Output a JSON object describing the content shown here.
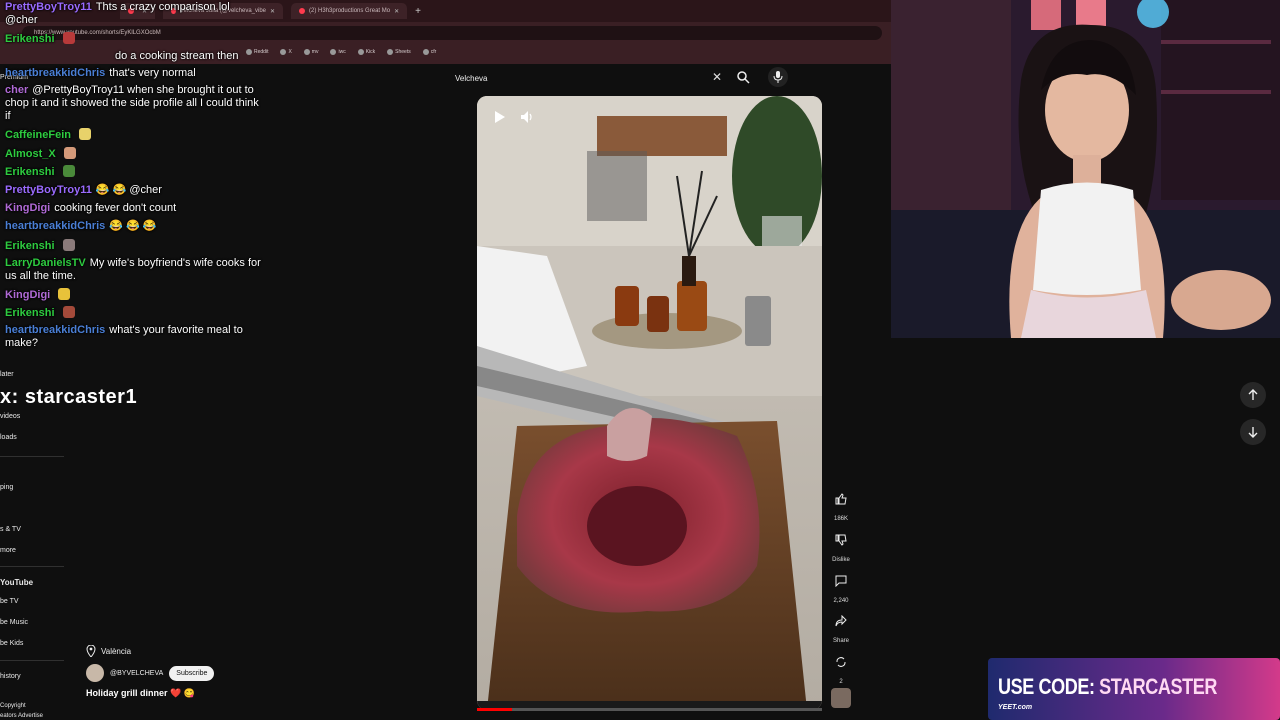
{
  "browser": {
    "tabs": [
      {
        "label": ""
      },
      {
        "label": "Velcheva Julia (@velcheva_vibe"
      },
      {
        "label": "(2) H3h3productions Great Mo"
      }
    ],
    "url": "https://www.youtube.com/shorts/EyKlLGXOcbM",
    "bookmarks": [
      "Reddit",
      "X",
      "mv",
      "iwc",
      "Kick",
      "Sheets",
      "cfr"
    ]
  },
  "sidebar": {
    "items": [
      {
        "label": "Premium"
      },
      {
        "label": "later"
      },
      {
        "label": "videos"
      },
      {
        "label": "loads"
      },
      {
        "label": "ping"
      },
      {
        "label": "s & TV"
      },
      {
        "label": "more"
      },
      {
        "label": "YouTube"
      },
      {
        "label": "be TV"
      },
      {
        "label": "be Music"
      },
      {
        "label": "be Kids"
      },
      {
        "label": "history"
      },
      {
        "label": "Copyright"
      },
      {
        "label": "eators  Advertise"
      }
    ]
  },
  "chat": {
    "messages": [
      {
        "user": "PrettyBoyTroy11",
        "color": "#9b6bff",
        "text": "Thts a crazy comparison lol @cher",
        "emote": ""
      },
      {
        "user": "Erikenshi",
        "color": "#2ecc40",
        "text": "",
        "emote": "#b83a3a"
      },
      {
        "user": "",
        "color": "#ffffff",
        "text": "do a cooking stream then",
        "emote": ""
      },
      {
        "user": "heartbreakkidChris",
        "color": "#4a7fd6",
        "text": "that's very normal",
        "emote": ""
      },
      {
        "user": "cher",
        "color": "#b06ad6",
        "text": "@PrettyBoyTroy11 when she brought it out to chop it and it showed the side profile all I could think if",
        "emote": ""
      },
      {
        "user": "CaffeineFein",
        "color": "#2ecc40",
        "text": "",
        "emote": "#e8d26a"
      },
      {
        "user": "Almost_X",
        "color": "#2ecc40",
        "text": "",
        "emote": "#d49a7a"
      },
      {
        "user": "Erikenshi",
        "color": "#2ecc40",
        "text": "",
        "emote": "#4a8a3a"
      },
      {
        "user": "PrettyBoyTroy11",
        "color": "#9b6bff",
        "text": "😂 😂 @cher",
        "emote": ""
      },
      {
        "user": "KingDigi",
        "color": "#b06ad6",
        "text": "cooking fever don't count",
        "emote": ""
      },
      {
        "user": "heartbreakkidChris",
        "color": "#4a7fd6",
        "text": "😂 😂 😂",
        "emote": ""
      },
      {
        "user": "Erikenshi",
        "color": "#2ecc40",
        "text": "",
        "emote": "#8a7a7a"
      },
      {
        "user": "LarryDanielsTV",
        "color": "#2ecc40",
        "text": "My wife's boyfriend's wife cooks for us all the time.",
        "emote": ""
      },
      {
        "user": "KingDigi",
        "color": "#b06ad6",
        "text": "",
        "emote": "#e8c23a"
      },
      {
        "user": "Erikenshi",
        "color": "#2ecc40",
        "text": "",
        "emote": "#a44a3a"
      },
      {
        "user": "heartbreakkidChris",
        "color": "#4a7fd6",
        "text": "what's your favorite meal to make?",
        "emote": ""
      }
    ]
  },
  "overlay": {
    "x_handle": "x: starcaster1"
  },
  "search": {
    "query": "Velcheva"
  },
  "video": {
    "progress": 0.1
  },
  "actions": {
    "like_count": "186K",
    "dislike_label": "Dislike",
    "comment_count": "2,240",
    "share_label": "Share",
    "remix_count": "2"
  },
  "video_info": {
    "location": "València",
    "channel": "@BYVELCHEVA",
    "subscribe_label": "Subscribe",
    "title": "Holiday grill dinner ❤️ 😋"
  },
  "promo": {
    "prefix": "USE CODE:",
    "code": "STARCASTER",
    "brand": "YEET.com"
  },
  "colors": {
    "accent": "#ff0000",
    "background": "#0f0f0f"
  }
}
